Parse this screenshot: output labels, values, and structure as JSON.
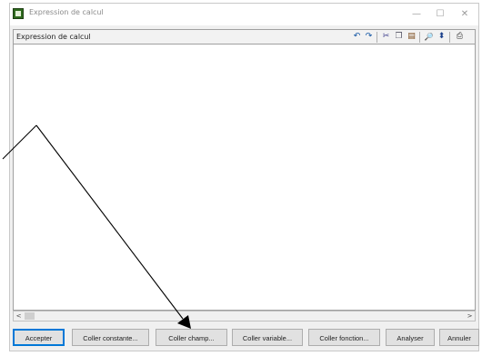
{
  "window": {
    "title": "Expression de calcul",
    "minimize_glyph": "—",
    "maximize_glyph": "☐",
    "close_glyph": "✕"
  },
  "panel": {
    "title": "Expression de calcul"
  },
  "toolbar": {
    "undo_glyph": "↶",
    "redo_glyph": "↷",
    "cut_glyph": "✂",
    "copy_glyph": "❐",
    "paste_glyph": "▤",
    "find_glyph": "🔎",
    "collapse_glyph": "⬍",
    "print_glyph": "⎙"
  },
  "scrollbar": {
    "left_glyph": "<",
    "right_glyph": ">"
  },
  "buttons": {
    "accept": "Accepter",
    "paste_constant": "Coller constante...",
    "paste_field": "Coller champ...",
    "paste_variable": "Coller variable...",
    "paste_function": "Coller fonction...",
    "analyze": "Analyser",
    "cancel": "Annuler"
  },
  "colors": {
    "accent": "#0078d7",
    "app_icon": "#2f6a1f"
  },
  "icons": [
    "app-icon",
    "undo-icon",
    "redo-icon",
    "cut-icon",
    "copy-icon",
    "paste-icon",
    "find-icon",
    "collapse-icon",
    "print-icon"
  ]
}
